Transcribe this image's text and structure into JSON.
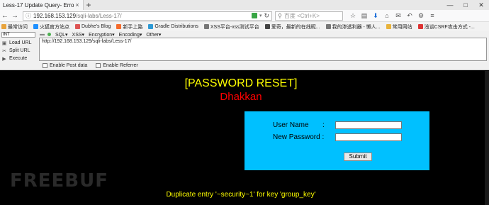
{
  "tab": {
    "title": "Less-17 Update Query- Erro...",
    "close": "×",
    "new": "+"
  },
  "window_controls": {
    "minimize": "—",
    "maximize": "□",
    "close": "✕"
  },
  "nav": {
    "back": "←",
    "forward": "→",
    "url_host": "192.168.153.129",
    "url_path": "/sqli-labs/Less-17/",
    "search_placeholder": "百度 <Ctrl+K>",
    "icons": [
      "star-icon",
      "clipboard-icon",
      "download-icon",
      "home-icon",
      "chat-icon",
      "undo-icon",
      "gear-icon",
      "menu-icon"
    ]
  },
  "bookmarks": [
    {
      "label": "最常访问",
      "color": "#e8a33c"
    },
    {
      "label": "火狐官方站点",
      "color": "#1e90ff"
    },
    {
      "label": "Dubhe's Blog",
      "color": "#d55"
    },
    {
      "label": "新手上路",
      "color": "#f56c2d"
    },
    {
      "label": "Gradle Distributions",
      "color": "#2d9ad5"
    },
    {
      "label": "XSS平台-xss测试平台",
      "color": "#777"
    },
    {
      "label": "爱奇，最新的在线昵...",
      "color": "#444"
    },
    {
      "label": "我的渗透利器 - 懒人...",
      "color": "#777"
    },
    {
      "label": "常用网站",
      "color": "#e8b33c"
    },
    {
      "label": "浅谈CSRF攻击方式 -...",
      "color": "#d33"
    }
  ],
  "hackbar": {
    "select": "INT",
    "menus": [
      "SQL▾",
      "XSS▾",
      "Encryption▾",
      "Encoding▾",
      "Other▾"
    ],
    "actions": [
      "Load URL",
      "Split URL",
      "Execute"
    ],
    "textarea": "http://192.168.153.129/sqli-labs/Less-17/",
    "options": [
      "Enable Post data",
      "Enable Referrer"
    ]
  },
  "page": {
    "title": "[PASSWORD RESET]",
    "subtitle": "Dhakkan",
    "username_label": "User Name       :",
    "password_label": "New Password :",
    "submit": "Submit",
    "watermark": "FREEBUF",
    "error": "Duplicate entry '~security~1' for key 'group_key'"
  },
  "colors": {
    "title": "#ffff00",
    "subtitle": "#ff0000",
    "form_bg": "#00c0ff",
    "error": "#ffff00"
  }
}
